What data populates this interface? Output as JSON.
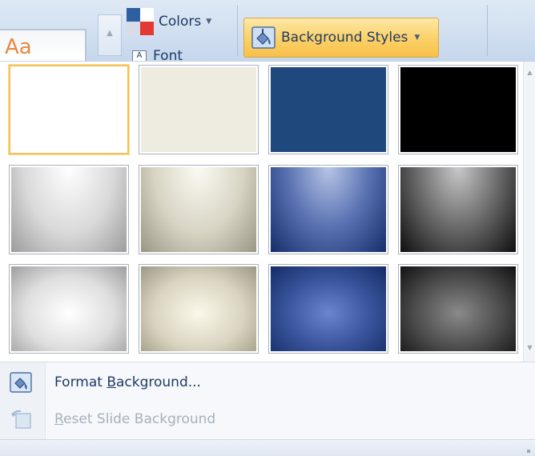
{
  "ribbon": {
    "theme_preview_text": "Aa",
    "colors_label": "Colors",
    "fonts_label_partial": "Font",
    "background_styles_label": "Background Styles"
  },
  "gallery": {
    "tiles": [
      {
        "name": "style-1",
        "fill": "#ffffff",
        "selected": true
      },
      {
        "name": "style-2",
        "fill": "#eeece1"
      },
      {
        "name": "style-3",
        "fill": "#1f497d"
      },
      {
        "name": "style-4",
        "fill": "#000000"
      },
      {
        "name": "style-5",
        "gradient": "radial-gradient(ellipse at 50% 0%, #ffffff 0%, #d9d9d9 55%, #9c9c9c 100%)"
      },
      {
        "name": "style-6",
        "gradient": "radial-gradient(ellipse at 50% 0%, #fcfbf3 0%, #d7d4c4 55%, #9a9684 100%)"
      },
      {
        "name": "style-7",
        "gradient": "radial-gradient(ellipse at 50% 0%, #b7c6e6 0%, #5a72b2 50%, #162d6a 100%)"
      },
      {
        "name": "style-8",
        "gradient": "radial-gradient(ellipse at 50% 0%, #c9c9c9 0%, #6b6b6b 50%, #0e0e0e 100%)"
      },
      {
        "name": "style-9",
        "gradient": "radial-gradient(ellipse at 50% 55%, #ffffff 0%, #dedede 55%, #9e9e9e 100%)"
      },
      {
        "name": "style-10",
        "gradient": "radial-gradient(ellipse at 50% 55%, #fbf8ea 0%, #d8d4c0 55%, #9c9885 100%)"
      },
      {
        "name": "style-11",
        "gradient": "radial-gradient(ellipse at 50% 55%, #6c86cc 0%, #3b569e 50%, #142b66 100%)"
      },
      {
        "name": "style-12",
        "gradient": "radial-gradient(ellipse at 50% 55%, #8a8a8a 0%, #4a4a4a 55%, #121212 100%)"
      }
    ]
  },
  "menu": {
    "format_background": {
      "pre": "Format ",
      "underline": "B",
      "post": "ackground..."
    },
    "reset_slide_background": {
      "pre": "",
      "underline": "R",
      "post": "eset Slide Background",
      "disabled": true
    }
  },
  "colors": {
    "ribbon_bg": "#d3e1f1",
    "highlight": "#fbd26a",
    "text": "#1f3a65",
    "disabled_text": "#a7b0bc"
  }
}
